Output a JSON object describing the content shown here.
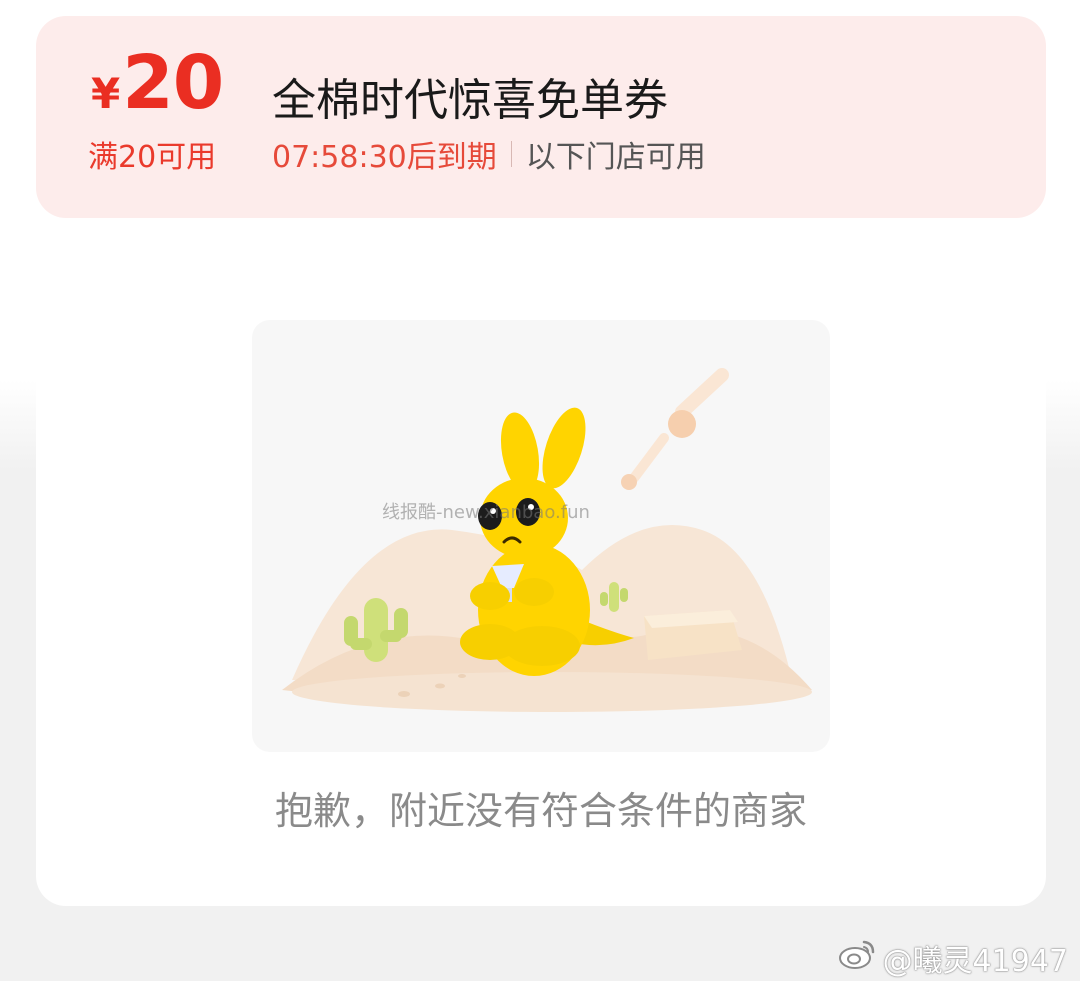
{
  "coupon": {
    "currency_symbol": "¥",
    "amount": "20",
    "threshold": "满20可用",
    "title": "全棉时代惊喜免单券",
    "expiry": "07:58:30后到期",
    "stores_link": "以下门店可用"
  },
  "empty_state": {
    "message": "抱歉，附近没有符合条件的商家",
    "watermark": "线报酷-new.xianbao.fun",
    "illustration": "kangaroo-desert-icon"
  },
  "credit": {
    "icon": "weibo-icon",
    "handle": "@曦灵41947"
  },
  "colors": {
    "accent": "#ea2e22",
    "coupon_bg": "#fdeceb",
    "mascot": "#ffd400"
  }
}
